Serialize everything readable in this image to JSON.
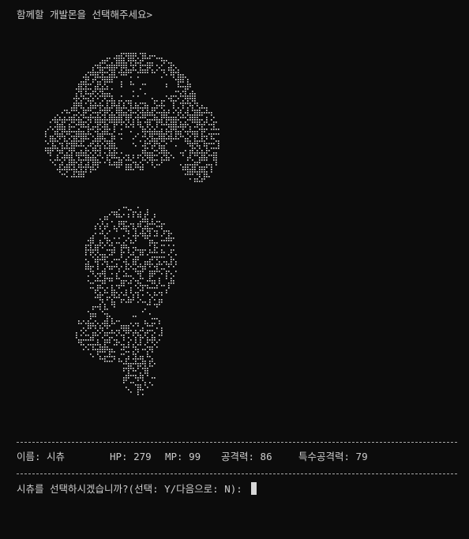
{
  "terminal": {
    "prompt_title": "함께할 개발몬을 선택해주세요>",
    "divider_text": "",
    "stats": {
      "name_label": "이름: 시츄",
      "hp": "HP: 279",
      "mp": "MP: 99",
      "attack": "공격력: 86",
      "special_attack": "특수공격력: 79"
    },
    "question": "시츄를 선택하시겠습니까?(선택: Y/다음으로: N): "
  },
  "art": {
    "subject": "dog-ascii-art",
    "color": "#e0e0e0"
  }
}
